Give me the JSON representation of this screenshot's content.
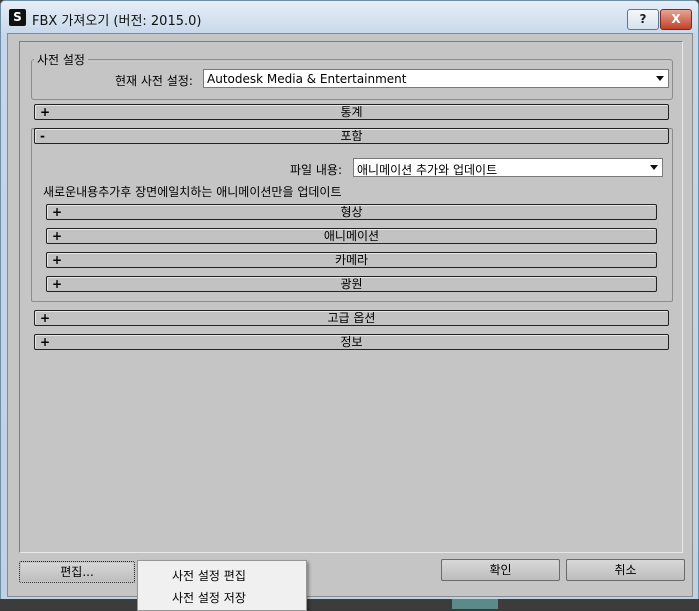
{
  "window": {
    "title": "FBX 가져오기 (버전: 2015.0)",
    "help_label": "?",
    "close_label": "X"
  },
  "preset": {
    "group_title": "사전 설정",
    "current_label": "현재 사전 설정:",
    "current_value": "Autodesk Media & Entertainment"
  },
  "rollouts": {
    "statistics": {
      "sign": "+",
      "title": "통계"
    },
    "include": {
      "sign": "-",
      "title": "포함"
    },
    "advanced": {
      "sign": "+",
      "title": "고급 옵션"
    },
    "info": {
      "sign": "+",
      "title": "정보"
    }
  },
  "include": {
    "file_content_label": "파일 내용:",
    "file_content_value": "애니메이션 추가와 업데이트",
    "description": "새로운내용추가후 장면에일치하는 애니메이션만을 업데이트",
    "sub_rollouts": [
      {
        "sign": "+",
        "title": "형상"
      },
      {
        "sign": "+",
        "title": "애니메이션"
      },
      {
        "sign": "+",
        "title": "카메라"
      },
      {
        "sign": "+",
        "title": "광원"
      }
    ]
  },
  "buttons": {
    "edit": "편집...",
    "ok": "확인",
    "cancel": "취소"
  },
  "edit_menu": {
    "items": [
      "사전 설정 편집",
      "사전 설정 저장"
    ]
  }
}
